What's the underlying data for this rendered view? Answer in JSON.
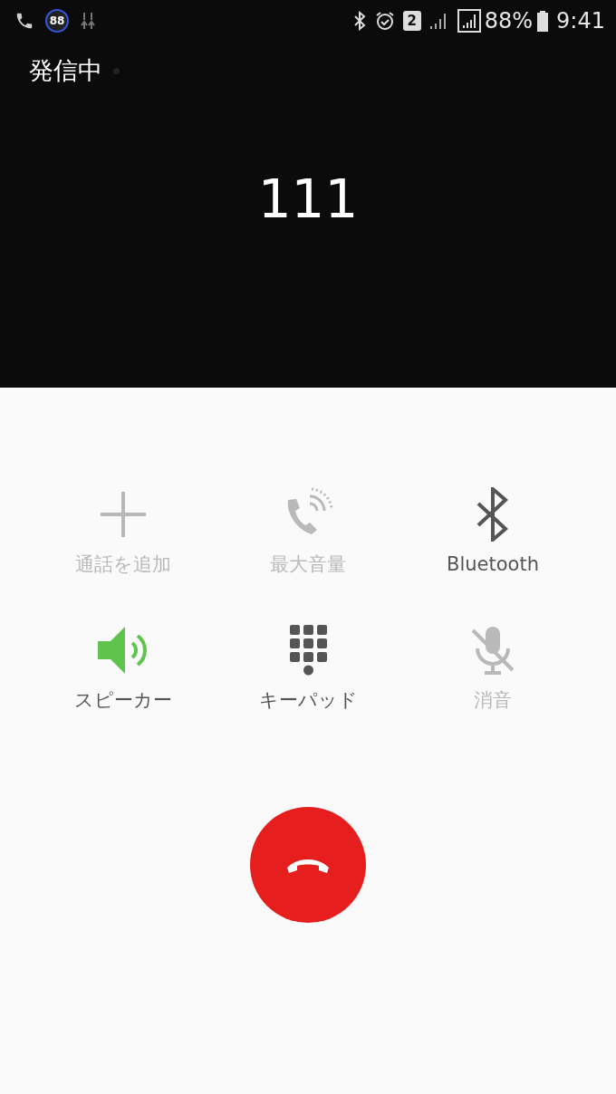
{
  "status_bar": {
    "notification_badge": "88",
    "sim_slot": "2",
    "battery": "88%",
    "time": "9:41"
  },
  "call": {
    "status": "発信中",
    "number": "111"
  },
  "buttons": [
    {
      "kind": "add",
      "label": "通話を追加",
      "disabled": true,
      "on": false
    },
    {
      "kind": "volume",
      "label": "最大音量",
      "disabled": true,
      "on": false
    },
    {
      "kind": "bluetooth",
      "label": "Bluetooth",
      "disabled": false,
      "on": false
    },
    {
      "kind": "speaker",
      "label": "スピーカー",
      "disabled": false,
      "on": true
    },
    {
      "kind": "keypad",
      "label": "キーパッド",
      "disabled": false,
      "on": false
    },
    {
      "kind": "mute",
      "label": "消音",
      "disabled": true,
      "on": false
    }
  ]
}
